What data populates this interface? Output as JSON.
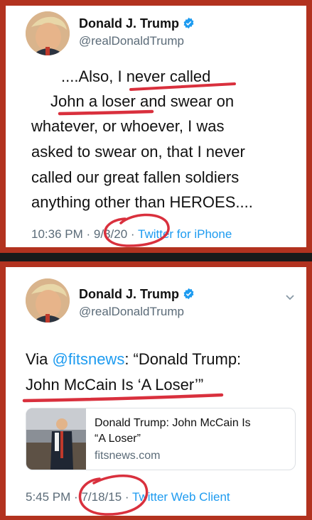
{
  "tweet_top": {
    "author_name": "Donald J. Trump",
    "author_handle": "@realDonaldTrump",
    "lines": [
      "....Also, I never called",
      "John a loser and swear on",
      "whatever, or whoever, I was",
      "asked to swear on, that I never",
      "called our great fallen soldiers",
      "anything other than HEROES...."
    ],
    "time": "10:36 PM",
    "sep1": "·",
    "date": "9/3/20",
    "sep2": "·",
    "source": "Twitter for iPhone",
    "avatar_icon": "profile-photo"
  },
  "tweet_bottom": {
    "author_name": "Donald J. Trump",
    "author_handle": "@realDonaldTrump",
    "line1_prefix": "Via ",
    "line1_mention": "@fitsnews",
    "line1_suffix": ": “Donald Trump:",
    "line2": "John McCain Is ‘A Loser’”",
    "card_title_line1": "Donald Trump: John McCain Is",
    "card_title_line2": "“A Loser”",
    "card_domain": "fitsnews.com",
    "time": "5:45 PM",
    "sep1": "·",
    "date": "7/18/15",
    "sep2": "·",
    "source": "Twitter Web Client",
    "chevron_icon": "chevron-down-icon"
  },
  "colors": {
    "frame": "#b2321f",
    "link": "#1d9bf0",
    "annotation": "#d9303d",
    "verified": "#1d9bf0"
  }
}
